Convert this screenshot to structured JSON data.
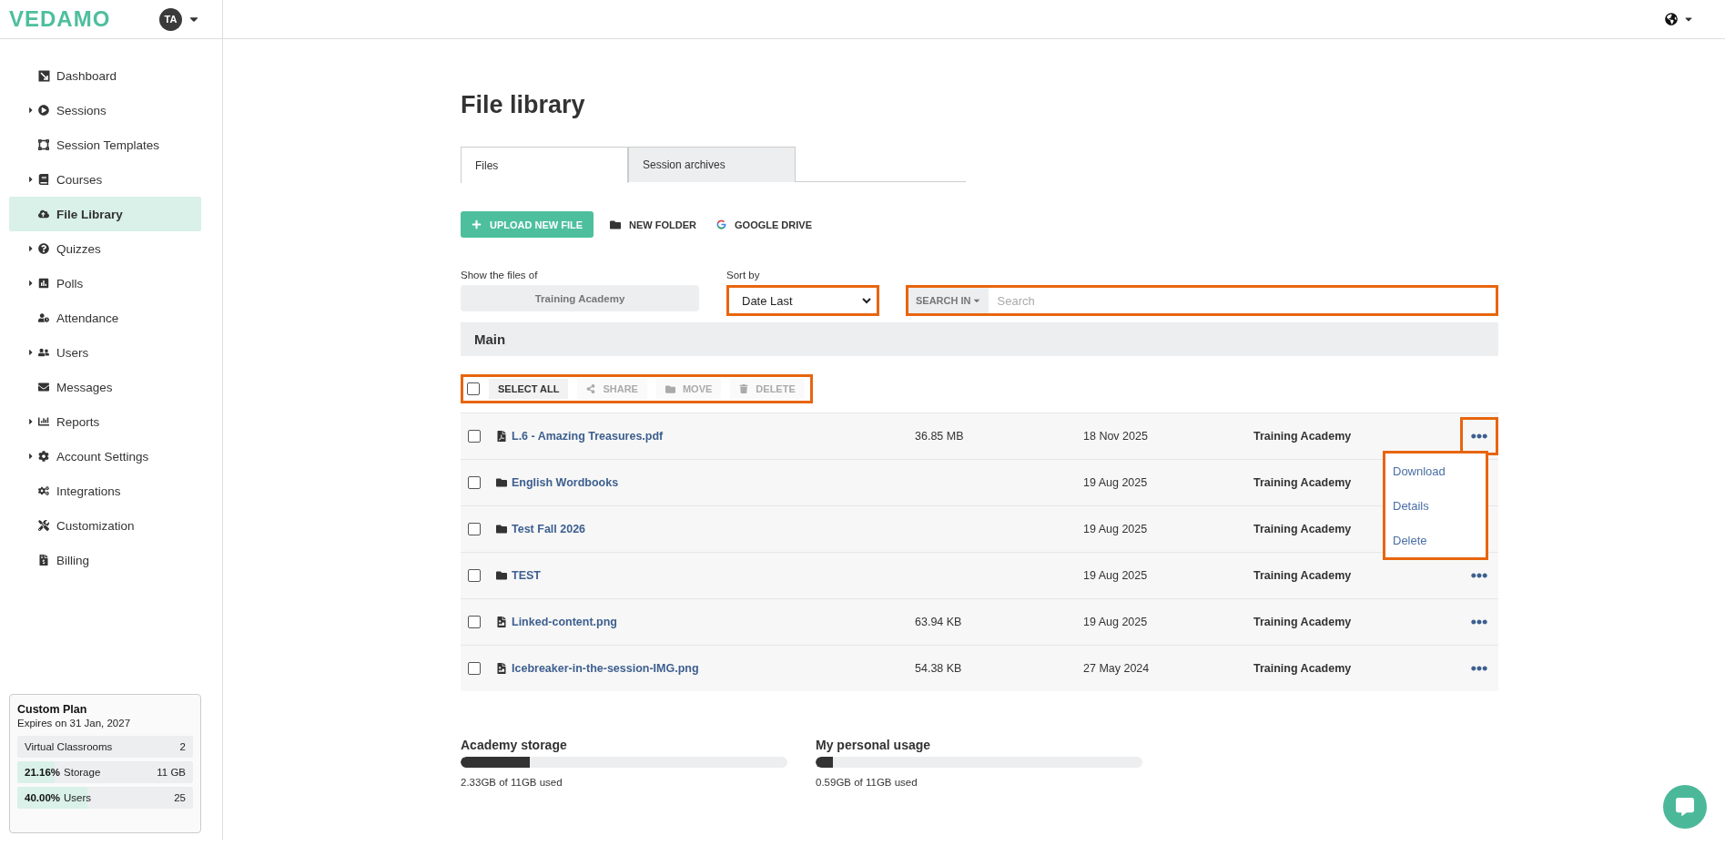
{
  "header": {
    "logo": "VEDAMO",
    "avatar": "TA"
  },
  "sidebar": {
    "items": [
      {
        "label": "Dashboard",
        "expandable": false,
        "selected": false
      },
      {
        "label": "Sessions",
        "expandable": true,
        "selected": false
      },
      {
        "label": "Session Templates",
        "expandable": false,
        "selected": false
      },
      {
        "label": "Courses",
        "expandable": true,
        "selected": false
      },
      {
        "label": "File Library",
        "expandable": false,
        "selected": true
      },
      {
        "label": "Quizzes",
        "expandable": true,
        "selected": false
      },
      {
        "label": "Polls",
        "expandable": true,
        "selected": false
      },
      {
        "label": "Attendance",
        "expandable": false,
        "selected": false
      },
      {
        "label": "Users",
        "expandable": true,
        "selected": false
      },
      {
        "label": "Messages",
        "expandable": false,
        "selected": false
      },
      {
        "label": "Reports",
        "expandable": true,
        "selected": false
      },
      {
        "label": "Account Settings",
        "expandable": true,
        "selected": false
      },
      {
        "label": "Integrations",
        "expandable": false,
        "selected": false
      },
      {
        "label": "Customization",
        "expandable": false,
        "selected": false
      },
      {
        "label": "Billing",
        "expandable": false,
        "selected": false
      }
    ]
  },
  "plan": {
    "title": "Custom Plan",
    "expires": "Expires on 31 Jan, 2027",
    "rows": [
      {
        "label": "Virtual Classrooms",
        "value": "2"
      },
      {
        "percent": "21.16%",
        "label": "Storage",
        "value": "11 GB",
        "level": 0.2116
      },
      {
        "percent": "40.00%",
        "label": "Users",
        "value": "25",
        "level": 0.4
      }
    ]
  },
  "title": "File library",
  "tabs": [
    {
      "label": "Files",
      "selected": true
    },
    {
      "label": "Session archives",
      "selected": false
    }
  ],
  "actions": [
    {
      "kind": "primary",
      "label": "UPLOAD NEW FILE"
    },
    {
      "kind": "folder",
      "label": "NEW FOLDER"
    },
    {
      "kind": "drive",
      "label": "GOOGLE DRIVE"
    }
  ],
  "filters": {
    "owner_label": "Show the files of",
    "owner": "Training Academy",
    "sort_label": "Sort by",
    "sort": {
      "value": "Date Last",
      "highlighted": true
    },
    "search": {
      "scope": "SEARCH IN",
      "placeholder": "Search",
      "highlighted": true
    }
  },
  "folder": "Main",
  "bulk": {
    "highlighted": true,
    "checked": false,
    "buttons": [
      {
        "kind": "select",
        "label": "SELECT ALL",
        "disabled": false
      },
      {
        "kind": "share",
        "label": "SHARE",
        "disabled": true
      },
      {
        "kind": "move",
        "label": "MOVE",
        "disabled": true
      },
      {
        "kind": "delete",
        "label": "DELETE",
        "disabled": true
      }
    ]
  },
  "rows": [
    {
      "kind": "pdf",
      "name": "L.6 - Amazing Treasures.pdf",
      "size": "36.85 MB",
      "date": "18 Nov 2025",
      "owner": "Training Academy",
      "checked": false,
      "more": {
        "highlighted": true
      },
      "menu": {
        "highlighted": true,
        "items": [
          "Download",
          "Details",
          "Delete"
        ]
      }
    },
    {
      "kind": "folder",
      "name": "English Wordbooks",
      "date": "19 Aug 2025",
      "owner": "Training Academy",
      "checked": false
    },
    {
      "kind": "folder",
      "name": "Test Fall 2026",
      "date": "19 Aug 2025",
      "owner": "Training Academy",
      "checked": false
    },
    {
      "kind": "folder",
      "name": "TEST",
      "date": "19 Aug 2025",
      "owner": "Training Academy",
      "checked": false,
      "more": {
        "highlighted": false
      }
    },
    {
      "kind": "image",
      "name": "Linked-content.png",
      "size": "63.94 KB",
      "date": "19 Aug 2025",
      "owner": "Training Academy",
      "checked": false,
      "more": {
        "highlighted": false
      }
    },
    {
      "kind": "image",
      "name": "Icebreaker-in-the-session-IMG.png",
      "size": "54.38 KB",
      "date": "27 May 2024",
      "owner": "Training Academy",
      "checked": false,
      "more": {
        "highlighted": false
      }
    }
  ],
  "storage": [
    {
      "label": "Academy storage",
      "level": 0.212,
      "caption": "2.33GB of 11GB used"
    },
    {
      "label": "My personal usage",
      "level": 0.054,
      "caption": "0.59GB of 11GB used"
    }
  ]
}
